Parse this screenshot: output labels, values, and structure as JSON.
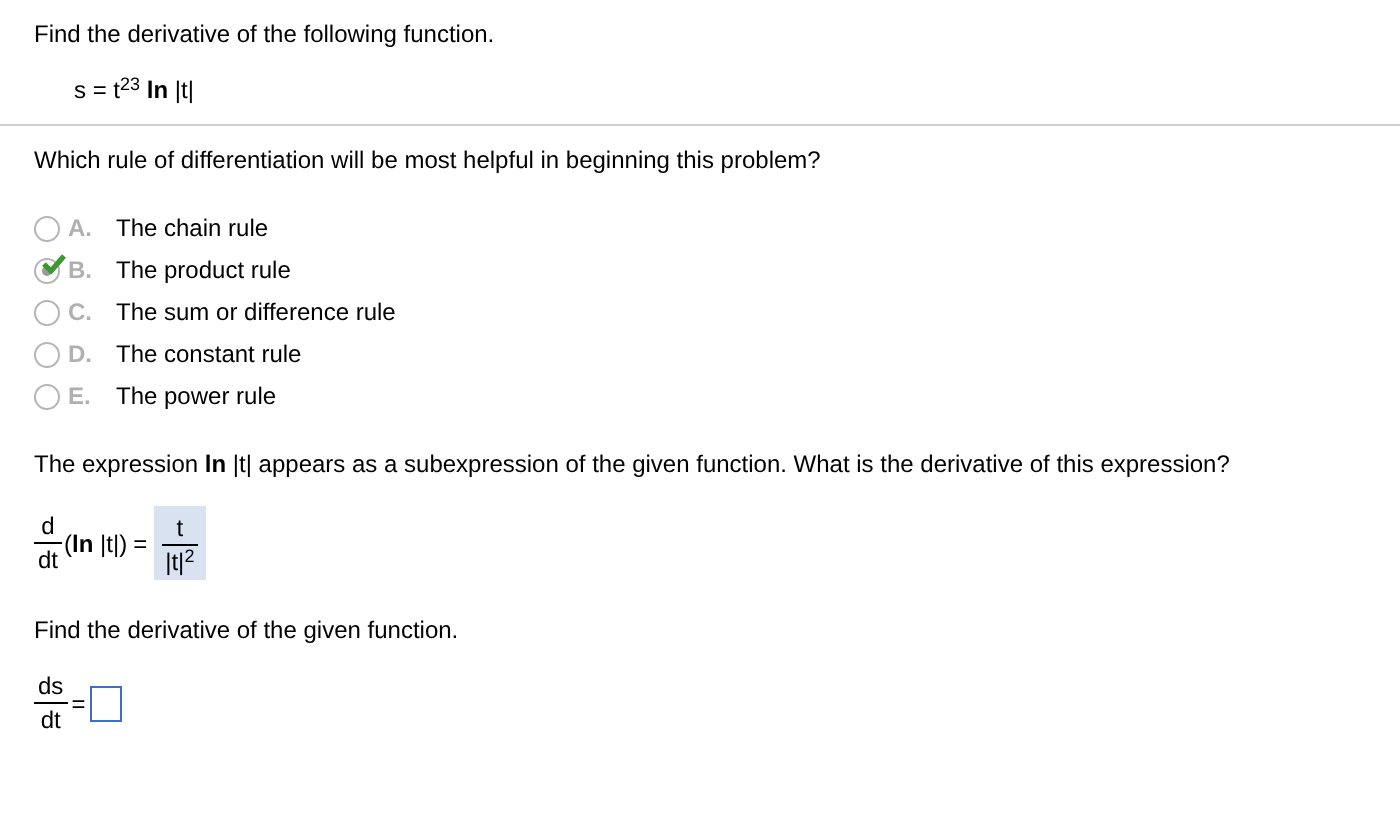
{
  "problem": {
    "instruction": "Find the derivative of the following function.",
    "function": "s = t$^{23}$ **ln** |t|"
  },
  "question": {
    "text": "Which rule of differentiation will be most helpful in beginning this problem?",
    "options": [
      {
        "letter": "A.",
        "text": "The chain rule",
        "selected": false
      },
      {
        "letter": "B.",
        "text": "The product rule",
        "selected": true
      },
      {
        "letter": "C.",
        "text": "The sum or difference rule",
        "selected": false
      },
      {
        "letter": "D.",
        "text": "The constant rule",
        "selected": false
      },
      {
        "letter": "E.",
        "text": "The power rule",
        "selected": false
      }
    ]
  },
  "subexpression": {
    "text": "The expression **ln** |t| appears as a subexpression of the given function. What is the derivative of this expression?",
    "operator_numerator": "d",
    "operator_denominator": "dt",
    "argument": "(**ln** |t|)",
    "equals": "=",
    "answer_numerator": "t",
    "answer_denominator": "|t|$^{2}$"
  },
  "final": {
    "text": "Find the derivative of the given function.",
    "numerator": "ds",
    "denominator": "dt",
    "equals": "="
  }
}
